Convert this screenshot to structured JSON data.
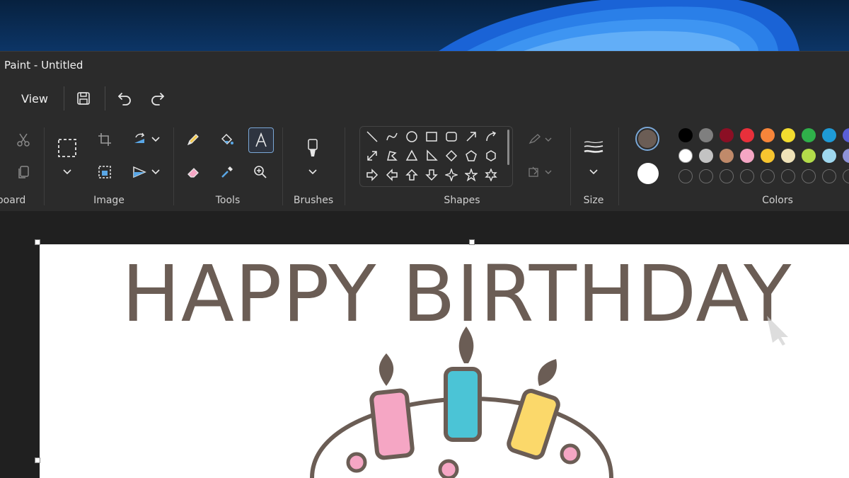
{
  "window": {
    "title": "Paint - Untitled"
  },
  "menu": {
    "view_label": "View"
  },
  "quick_access": {
    "save_icon": "save-icon",
    "undo_icon": "undo-icon",
    "redo_icon": "redo-icon"
  },
  "ribbon": {
    "groups": {
      "clipboard": "board",
      "image": "Image",
      "tools": "Tools",
      "brushes": "Brushes",
      "shapes": "Shapes",
      "size": "Size",
      "colors": "Colors"
    }
  },
  "colors": {
    "primary": "#6b5d55",
    "secondary": "#ffffff",
    "palette_row1": [
      "#000000",
      "#7f7f7f",
      "#8b0f24",
      "#e8303b",
      "#f7853a",
      "#f2dc2f",
      "#2fb04a",
      "#1e9ad6",
      "#5a5ed6"
    ],
    "palette_row2": [
      "#ffffff",
      "#c3c3c3",
      "#c08a6a",
      "#f5a6c4",
      "#f7c52f",
      "#efe2b8",
      "#b3dc4a",
      "#9fd8ef",
      "#8e93d8"
    ]
  },
  "canvas": {
    "text": "HAPPY BIRTHDAY",
    "text_color": "#6b5d55"
  }
}
